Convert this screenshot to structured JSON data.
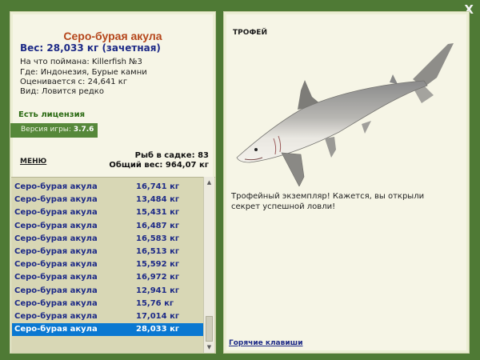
{
  "window": {
    "close_label": "X"
  },
  "fish": {
    "title": "Серо-бурая акула",
    "weight": "Вес: 28,033 кг (зачетная)",
    "caught_on": "На что поймана: Killerfish №3",
    "where": "Где: Индонезия, Бурые камни",
    "valued_from": "Оценивается с: 24,641 кг",
    "type": "Вид: Ловится редко"
  },
  "license": "Есть лицензия",
  "version": {
    "label": "Версия игры:",
    "value": "3.7.6"
  },
  "menu_label": "МЕНЮ",
  "stats": {
    "fish_in_cage": "Рыб в садке: 83",
    "total_weight": "Общий вес: 964,07 кг"
  },
  "catch_list": [
    {
      "name": "Серо-бурая акула",
      "weight": "16,741 кг"
    },
    {
      "name": "Серо-бурая акула",
      "weight": "13,484 кг"
    },
    {
      "name": "Серо-бурая акула",
      "weight": "15,431 кг"
    },
    {
      "name": "Серо-бурая акула",
      "weight": "16,487 кг"
    },
    {
      "name": "Серо-бурая акула",
      "weight": "16,583 кг"
    },
    {
      "name": "Серо-бурая акула",
      "weight": "16,513 кг"
    },
    {
      "name": "Серо-бурая акула",
      "weight": "15,592 кг"
    },
    {
      "name": "Серо-бурая акула",
      "weight": "16,972 кг"
    },
    {
      "name": "Серо-бурая акула",
      "weight": "12,941 кг"
    },
    {
      "name": "Серо-бурая акула",
      "weight": "15,76 кг"
    },
    {
      "name": "Серо-бурая акула",
      "weight": "17,014 кг"
    },
    {
      "name": "Серо-бурая акула",
      "weight": "28,033 кг"
    }
  ],
  "selected_index": 11,
  "trophy": {
    "label": "ТРОФЕЙ",
    "text": "Трофейный экземпляр! Кажется, вы открыли секрет успешной ловли!"
  },
  "hotkeys_label": "Горячие клавиши",
  "colors": {
    "background": "#4f7a35",
    "panel": "#f6f5e6",
    "title": "#b5461b",
    "accent_blue": "#1d2a87",
    "selection": "#0a78d1"
  },
  "icons": [
    "close-icon",
    "shark-image",
    "scroll-up-icon",
    "scroll-down-icon"
  ]
}
